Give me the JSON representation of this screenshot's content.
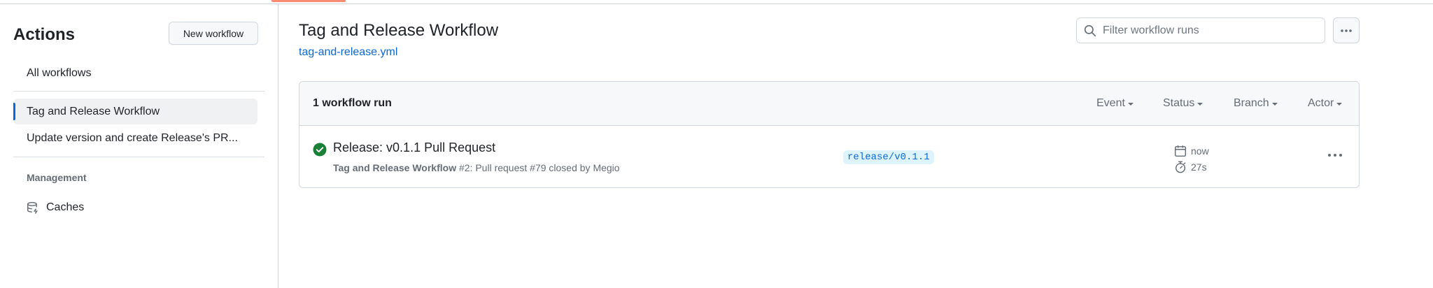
{
  "sidebar": {
    "title": "Actions",
    "new_workflow_label": "New workflow",
    "all_workflows_label": "All workflows",
    "workflows": [
      {
        "label": "Tag and Release Workflow",
        "selected": true
      },
      {
        "label": "Update version and create Release's PR...",
        "selected": false
      }
    ],
    "management_label": "Management",
    "caches_label": "Caches",
    "caches_icon": "database-icon"
  },
  "main": {
    "title": "Tag and Release Workflow",
    "file_link": "tag-and-release.yml",
    "filter_placeholder": "Filter workflow runs",
    "runs_count": "1 workflow run",
    "filters": {
      "event": "Event",
      "status": "Status",
      "branch": "Branch",
      "actor": "Actor"
    },
    "runs": [
      {
        "title": "Release: v0.1.1 Pull Request",
        "workflow_name": "Tag and Release Workflow",
        "details": " #2: Pull request #79 closed by Megio",
        "branch": "release/v0.1.1",
        "time": "now",
        "duration": "27s",
        "status": "success"
      }
    ]
  },
  "colors": {
    "accent": "#0969da",
    "success": "#1a7f37",
    "active_tab": "#fd8c73",
    "branch_bg": "#ddf4ff"
  }
}
